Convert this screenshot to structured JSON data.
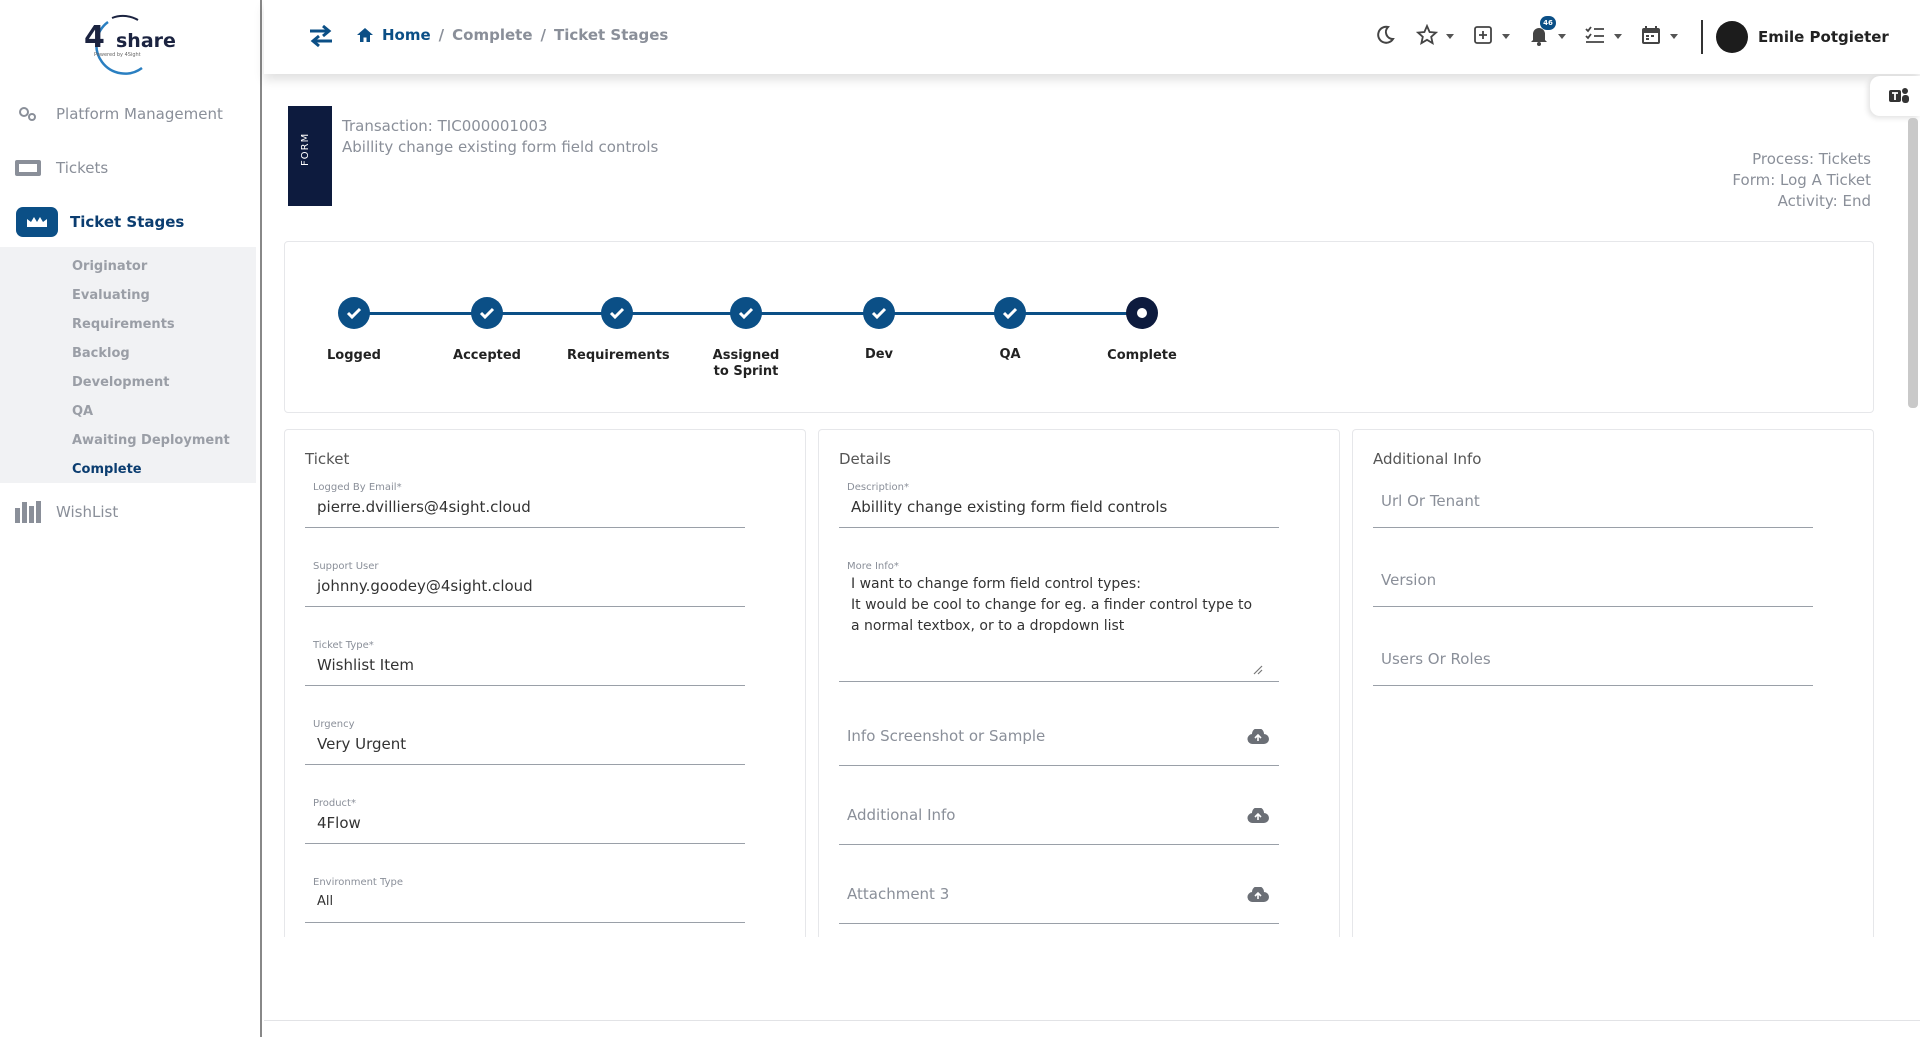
{
  "sidebar": {
    "logo": {
      "text": "share",
      "digit": "4",
      "sub": "Powered by 4Sight"
    },
    "items": [
      {
        "label": "Platform Management",
        "icon": "gears-icon"
      },
      {
        "label": "Tickets",
        "icon": "ticket-icon"
      },
      {
        "label": "Ticket Stages",
        "icon": "stages-icon",
        "active": true
      },
      {
        "label": "WishList",
        "icon": "wishlist-icon"
      }
    ],
    "subitems": [
      "Originator",
      "Evaluating",
      "Requirements",
      "Backlog",
      "Development",
      "QA",
      "Awaiting Deployment",
      "Complete"
    ]
  },
  "header": {
    "breadcrumb": [
      "Home",
      "Complete",
      "Ticket Stages"
    ],
    "notification_count": "46",
    "user_name": "Emile Potgieter"
  },
  "form": {
    "tag": "FORM",
    "transaction": "Transaction: TIC000001003",
    "summary": "Abillity change existing form field controls",
    "process": "Process: Tickets",
    "form_name": "Form: Log A Ticket",
    "activity": "Activity: End"
  },
  "stepper": {
    "steps": [
      "Logged",
      "Accepted",
      "Requirements",
      "Assigned\nto Sprint",
      "Dev",
      "QA",
      "Complete"
    ],
    "current_step": "Complete"
  },
  "ticket_panel": {
    "title": "Ticket",
    "fields": [
      {
        "label": "Logged By Email*",
        "value": "pierre.dvilliers@4sight.cloud"
      },
      {
        "label": "Support User",
        "value": "johnny.goodey@4sight.cloud"
      },
      {
        "label": "Ticket Type*",
        "value": "Wishlist Item"
      },
      {
        "label": "Urgency",
        "value": "Very Urgent"
      },
      {
        "label": "Product*",
        "value": "4Flow"
      },
      {
        "label": "Environment Type",
        "value": "All"
      }
    ]
  },
  "details_panel": {
    "title": "Details",
    "description_label": "Description*",
    "description_value": "Abillity change existing form field controls",
    "more_info_label": "More Info*",
    "more_info_value": "I want to change form field control types:\nIt would be cool to change for eg. a finder control type to\na normal textbox, or to a dropdown list",
    "uploads": [
      "Info Screenshot or Sample",
      "Additional Info",
      "Attachment 3"
    ]
  },
  "additional_panel": {
    "title": "Additional Info",
    "fields": [
      "Url Or Tenant",
      "Version",
      "Users Or Roles"
    ]
  },
  "colors": {
    "primary": "#0b4f86",
    "navy": "#0d1b3e",
    "muted_text": "#8a8f99"
  }
}
